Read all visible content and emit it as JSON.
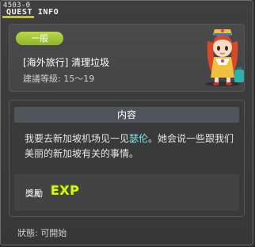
{
  "window": {
    "id": "4503-0",
    "title": "QUEST INFO"
  },
  "quest": {
    "category": "一般",
    "name": "[海外旅行] 清理垃圾",
    "level": "建議等級: 15～19"
  },
  "content": {
    "header": "内容",
    "description_before": "我要去新加坡机场见一见",
    "description_highlight": "瑟伦",
    "description_after": "。她会说一些跟我们美丽的新加坡有关的事情。"
  },
  "reward": {
    "label": "獎勵",
    "icon_text": "EXP",
    "icon": "exp-icon"
  },
  "status": {
    "text": "狀態: 可開始"
  },
  "colors": {
    "badge": "#a6c83a",
    "highlight": "#7fe8ef",
    "exp": "#d6f226"
  }
}
